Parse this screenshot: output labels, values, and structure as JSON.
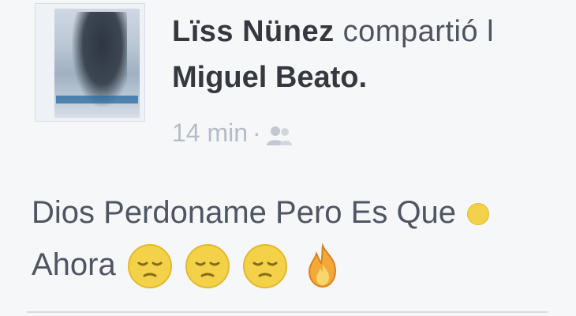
{
  "post": {
    "author_name": "Lïss Nünez",
    "shared_text": "compartió l",
    "shared_target": "Miguel Beato.",
    "timestamp": "14 min",
    "separator": "·",
    "audience_icon": "friends-icon",
    "message_line1": "Dios Perdoname Pero Es Que",
    "message_line2": "Ahora",
    "emojis": [
      "disappointed-face-icon",
      "disappointed-face-icon",
      "disappointed-face-icon",
      "fire-icon"
    ]
  },
  "colors": {
    "background": "#f6f7f9",
    "name": "#35393f",
    "body_text": "#4f5562",
    "meta": "#b6bcc6",
    "emoji_face": "#f3d24a"
  }
}
